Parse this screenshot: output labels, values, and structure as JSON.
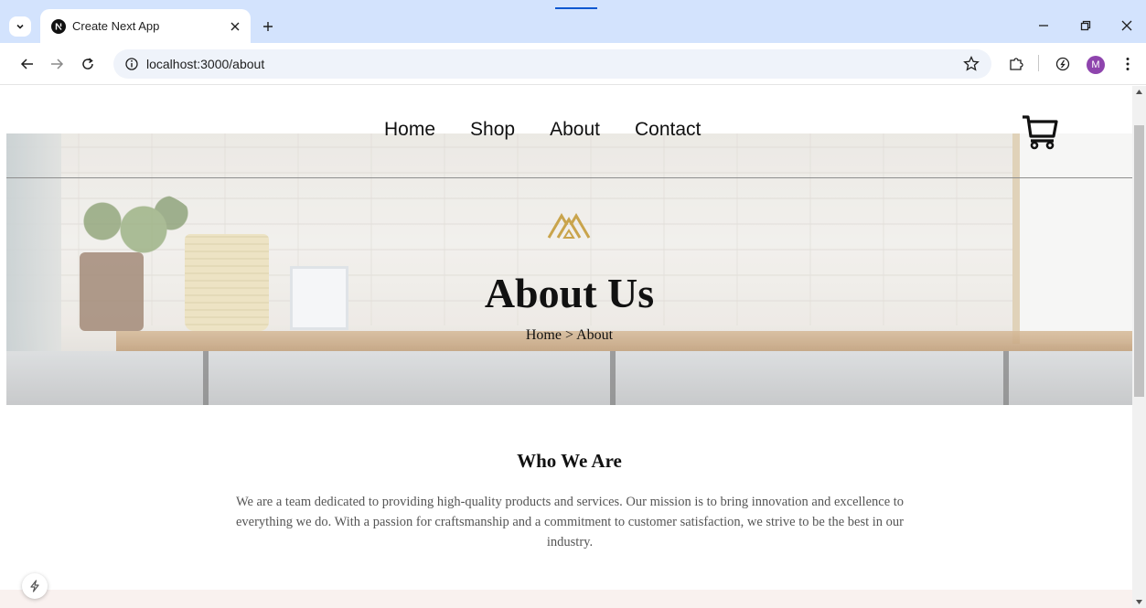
{
  "browser": {
    "tab_title": "Create Next App",
    "url": "localhost:3000/about",
    "avatar_initial": "M",
    "accent_color": "#0b57d0",
    "tabbar_color": "#d3e3fd"
  },
  "site": {
    "nav": [
      "Home",
      "Shop",
      "About",
      "Contact"
    ],
    "cart_icon": "shopping-cart-icon",
    "logo_color": "#c9a44c"
  },
  "hero": {
    "title": "About Us",
    "breadcrumb": "Home > About"
  },
  "who": {
    "title": "Who We Are",
    "text": "We are a team dedicated to providing high-quality products and services. Our mission is to bring innovation and excellence to everything we do. With a passion for craftsmanship and a commitment to customer satisfaction, we strive to be the best in our industry."
  }
}
